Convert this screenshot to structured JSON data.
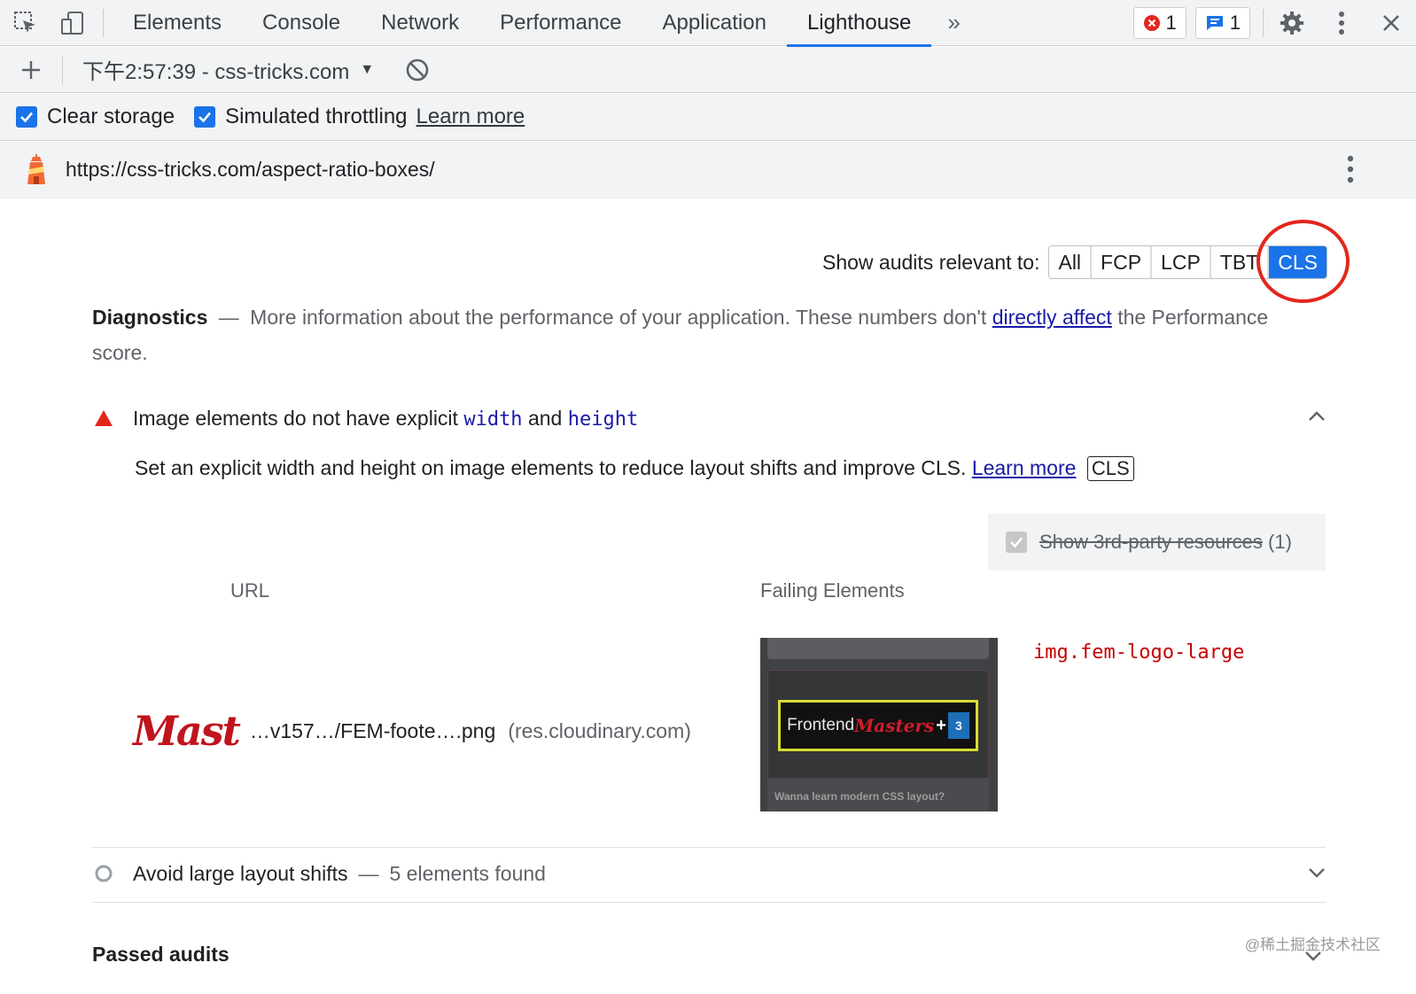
{
  "tabs": [
    "Elements",
    "Console",
    "Network",
    "Performance",
    "Application",
    "Lighthouse"
  ],
  "active_tab": "Lighthouse",
  "tab_more_label": "»",
  "badges": {
    "errors": "1",
    "messages": "1"
  },
  "report": {
    "selected": "下午2:57:39 - css-tricks.com"
  },
  "options": {
    "clear_storage": "Clear storage",
    "simulated_throttling": "Simulated throttling",
    "learn_more": "Learn more"
  },
  "url": "https://css-tricks.com/aspect-ratio-boxes/",
  "filter": {
    "label": "Show audits relevant to:",
    "buttons": [
      "All",
      "FCP",
      "LCP",
      "TBT",
      "CLS"
    ],
    "selected": "CLS"
  },
  "diagnostics": {
    "title": "Diagnostics",
    "dash": "—",
    "text_before": "More information about the performance of your application. These numbers don't",
    "link": "directly affect",
    "text_after": "the Performance score."
  },
  "audit1": {
    "title_before": "Image elements do not have explicit",
    "code1": "width",
    "and": "and",
    "code2": "height",
    "description": "Set an explicit width and height on image elements to reduce layout shifts and improve CLS.",
    "learn_more": "Learn more",
    "tag": "CLS",
    "third_party_label": "Show 3rd-party resources",
    "third_party_count": "(1)",
    "col_url": "URL",
    "col_failing": "Failing Elements",
    "row": {
      "thumb_text": "Mast",
      "url_path": "…v157…/FEM-foote….png",
      "host": "(res.cloudinary.com)",
      "selector": "img.fem-logo-large",
      "preview": {
        "logo_left": "Frontend",
        "logo_right": "Masters",
        "logo_plus": "+",
        "css_badge": "3",
        "cta": "Wanna learn modern CSS layout?"
      }
    }
  },
  "audit2": {
    "title": "Avoid large layout shifts",
    "dash": "—",
    "subtitle": "5 elements found"
  },
  "passed_audits": "Passed audits",
  "watermark": "@稀土掘金技术社区",
  "colors": {
    "accent": "#1a73e8",
    "link": "#1a1aa6",
    "fail": "#e3261c",
    "selector": "#c80000"
  }
}
